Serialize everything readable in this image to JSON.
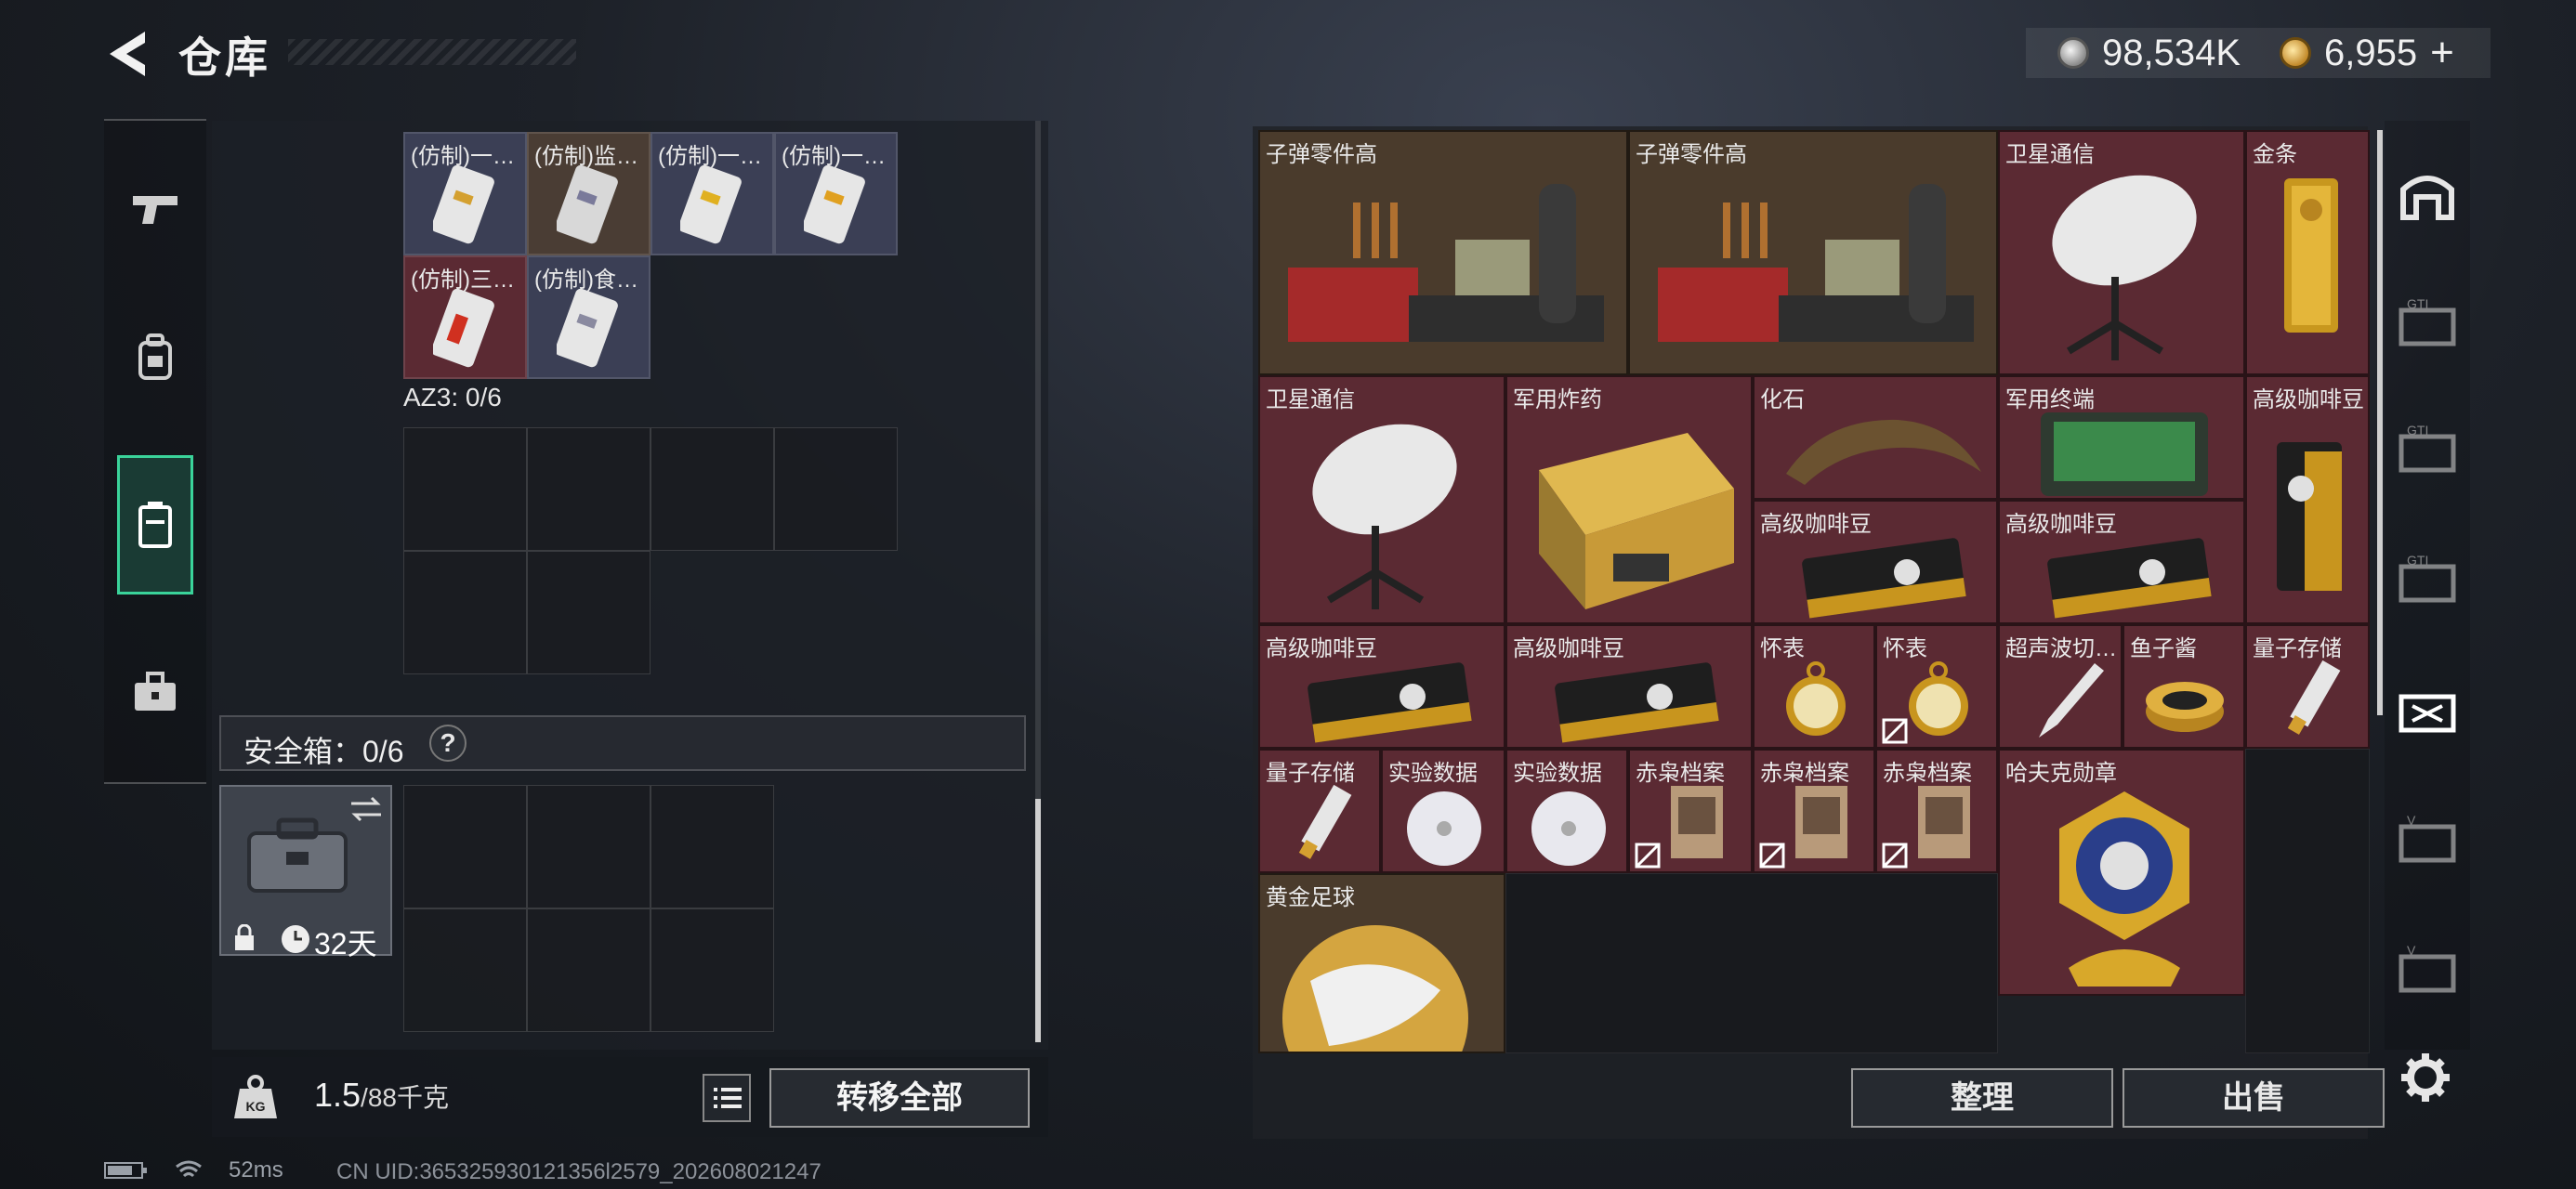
{
  "header": {
    "title": "仓库",
    "currency": [
      {
        "icon": "silver-coin-icon",
        "value": "98,534K"
      },
      {
        "icon": "gold-coin-icon",
        "value": "6,955"
      }
    ],
    "plus": "+"
  },
  "left_nav": {
    "items": [
      "weapon-icon",
      "backpack-icon",
      "storage-box-icon",
      "toolbox-icon"
    ],
    "active": 2
  },
  "left_panel": {
    "top_items": [
      {
        "label": "(仿制)一…"
      },
      {
        "label": "(仿制)监…"
      },
      {
        "label": "(仿制)一…"
      },
      {
        "label": "(仿制)一…"
      },
      {
        "label": "(仿制)三…"
      },
      {
        "label": "(仿制)食…"
      }
    ],
    "az3_label": "AZ3: 0/6",
    "safe_label": "安全箱：0/6",
    "help": "?",
    "case_timer": "32天",
    "weight": "1.5",
    "weight_max": "/88千克",
    "transfer_all": "转移全部"
  },
  "right_panel": {
    "items": [
      {
        "label": "子弹零件高"
      },
      {
        "label": "子弹零件高"
      },
      {
        "label": "卫星通信"
      },
      {
        "label": "金条"
      },
      {
        "label": "卫星通信"
      },
      {
        "label": "军用炸药"
      },
      {
        "label": "化石"
      },
      {
        "label": "军用终端"
      },
      {
        "label": "高级咖啡豆"
      },
      {
        "label": "高级咖啡豆"
      },
      {
        "label": "高级咖啡豆"
      },
      {
        "label": "高级咖啡豆"
      },
      {
        "label": "高级咖啡豆"
      },
      {
        "label": "怀表"
      },
      {
        "label": "怀表"
      },
      {
        "label": "超声波切…"
      },
      {
        "label": "鱼子酱"
      },
      {
        "label": "量子存储"
      },
      {
        "label": "量子存储"
      },
      {
        "label": "实验数据"
      },
      {
        "label": "实验数据"
      },
      {
        "label": "赤枭档案"
      },
      {
        "label": "赤枭档案"
      },
      {
        "label": "赤枭档案"
      },
      {
        "label": "哈夫克勋章"
      },
      {
        "label": "黄金足球"
      }
    ],
    "tidy": "整理",
    "sell": "出售"
  },
  "status": {
    "ping": "52ms",
    "uid": "CN UID:365325930121356l2579_202608021247"
  }
}
